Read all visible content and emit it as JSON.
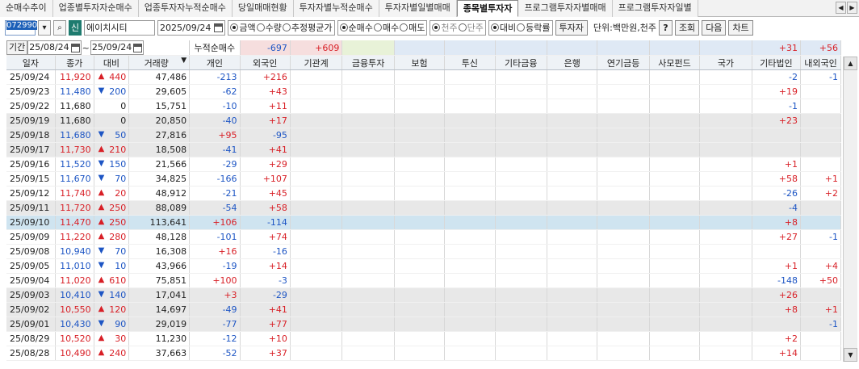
{
  "tabs": [
    "순매수추이",
    "업종별투자자순매수",
    "업종투자자누적순매수",
    "당일매매현황",
    "투자자별누적순매수",
    "투자자별일별매매",
    "종목별투자자",
    "프로그램투자자별매매",
    "프로그램투자자일별"
  ],
  "active_tab": 6,
  "toolbar": {
    "code": "072990",
    "shin_label": "신",
    "name": "에이치시티",
    "date": "2025/09/24",
    "radio1": [
      "금액",
      "수량",
      "추정평균가"
    ],
    "radio2": [
      "순매수",
      "매수",
      "매도"
    ],
    "radio3": [
      "천주",
      "단주"
    ],
    "radio4": [
      "대비",
      "등락률"
    ],
    "investor_btn": "투자자",
    "unit": "단위:백만원,천주",
    "help": "?",
    "search_btn": "조회",
    "next_btn": "다음",
    "chart_btn": "차트"
  },
  "period": {
    "label": "기간",
    "from": "25/08/24",
    "to": "25/09/24",
    "cumulative_label": "누적순매수"
  },
  "summary": {
    "individual": "-697",
    "foreign": "+609",
    "other_corp": "+31",
    "domestic_foreign": "+56"
  },
  "columns": [
    "일자",
    "종가",
    "대비",
    "거래량",
    "개인",
    "외국인",
    "기관계",
    "금융투자",
    "보험",
    "투신",
    "기타금융",
    "은행",
    "연기금등",
    "사모펀드",
    "국가",
    "기타법인",
    "내외국인"
  ],
  "rows": [
    {
      "date": "25/09/24",
      "close": "11,920",
      "dir": "up",
      "diff": "440",
      "vol": "47,486",
      "ind": "-213",
      "for": "+216",
      "corp": "-2",
      "dom": "-1"
    },
    {
      "date": "25/09/23",
      "close": "11,480",
      "dir": "dn",
      "diff": "200",
      "vol": "29,605",
      "ind": "-62",
      "for": "+43",
      "corp": "+19",
      "dom": ""
    },
    {
      "date": "25/09/22",
      "close": "11,680",
      "dir": "flat",
      "diff": "0",
      "vol": "15,751",
      "ind": "-10",
      "for": "+11",
      "corp": "-1",
      "dom": ""
    },
    {
      "date": "25/09/19",
      "close": "11,680",
      "dir": "flat",
      "diff": "0",
      "vol": "20,850",
      "ind": "-40",
      "for": "+17",
      "corp": "+23",
      "dom": ""
    },
    {
      "date": "25/09/18",
      "close": "11,680",
      "dir": "dn",
      "diff": "50",
      "vol": "27,816",
      "ind": "+95",
      "for": "-95",
      "corp": "",
      "dom": ""
    },
    {
      "date": "25/09/17",
      "close": "11,730",
      "dir": "up",
      "diff": "210",
      "vol": "18,508",
      "ind": "-41",
      "for": "+41",
      "corp": "",
      "dom": ""
    },
    {
      "date": "25/09/16",
      "close": "11,520",
      "dir": "dn",
      "diff": "150",
      "vol": "21,566",
      "ind": "-29",
      "for": "+29",
      "corp": "+1",
      "dom": ""
    },
    {
      "date": "25/09/15",
      "close": "11,670",
      "dir": "dn",
      "diff": "70",
      "vol": "34,825",
      "ind": "-166",
      "for": "+107",
      "corp": "+58",
      "dom": "+1"
    },
    {
      "date": "25/09/12",
      "close": "11,740",
      "dir": "up",
      "diff": "20",
      "vol": "48,912",
      "ind": "-21",
      "for": "+45",
      "corp": "-26",
      "dom": "+2"
    },
    {
      "date": "25/09/11",
      "close": "11,720",
      "dir": "up",
      "diff": "250",
      "vol": "88,089",
      "ind": "-54",
      "for": "+58",
      "corp": "-4",
      "dom": ""
    },
    {
      "date": "25/09/10",
      "close": "11,470",
      "dir": "up",
      "diff": "250",
      "vol": "113,641",
      "ind": "+106",
      "for": "-114",
      "corp": "+8",
      "dom": ""
    },
    {
      "date": "25/09/09",
      "close": "11,220",
      "dir": "up",
      "diff": "280",
      "vol": "48,128",
      "ind": "-101",
      "for": "+74",
      "corp": "+27",
      "dom": "-1"
    },
    {
      "date": "25/09/08",
      "close": "10,940",
      "dir": "dn",
      "diff": "70",
      "vol": "16,308",
      "ind": "+16",
      "for": "-16",
      "corp": "",
      "dom": ""
    },
    {
      "date": "25/09/05",
      "close": "11,010",
      "dir": "dn",
      "diff": "10",
      "vol": "43,966",
      "ind": "-19",
      "for": "+14",
      "corp": "+1",
      "dom": "+4"
    },
    {
      "date": "25/09/04",
      "close": "11,020",
      "dir": "up",
      "diff": "610",
      "vol": "75,851",
      "ind": "+100",
      "for": "-3",
      "corp": "-148",
      "dom": "+50"
    },
    {
      "date": "25/09/03",
      "close": "10,410",
      "dir": "dn",
      "diff": "140",
      "vol": "17,041",
      "ind": "+3",
      "for": "-29",
      "corp": "+26",
      "dom": ""
    },
    {
      "date": "25/09/02",
      "close": "10,550",
      "dir": "up",
      "diff": "120",
      "vol": "14,697",
      "ind": "-49",
      "for": "+41",
      "corp": "+8",
      "dom": "+1"
    },
    {
      "date": "25/09/01",
      "close": "10,430",
      "dir": "dn",
      "diff": "90",
      "vol": "29,019",
      "ind": "-77",
      "for": "+77",
      "corp": "",
      "dom": "-1"
    },
    {
      "date": "25/08/29",
      "close": "10,520",
      "dir": "up",
      "diff": "30",
      "vol": "11,230",
      "ind": "-12",
      "for": "+10",
      "corp": "+2",
      "dom": ""
    },
    {
      "date": "25/08/28",
      "close": "10,490",
      "dir": "up",
      "diff": "240",
      "vol": "37,663",
      "ind": "-52",
      "for": "+37",
      "corp": "+14",
      "dom": ""
    }
  ],
  "colors": {
    "up": "#d81f26",
    "down": "#1d55c4",
    "selected_row": "#cfe4f0",
    "band": "#e8e8e8"
  },
  "selected_row": 10,
  "band_rows": [
    3,
    4,
    5,
    9,
    10,
    15,
    16,
    17
  ]
}
